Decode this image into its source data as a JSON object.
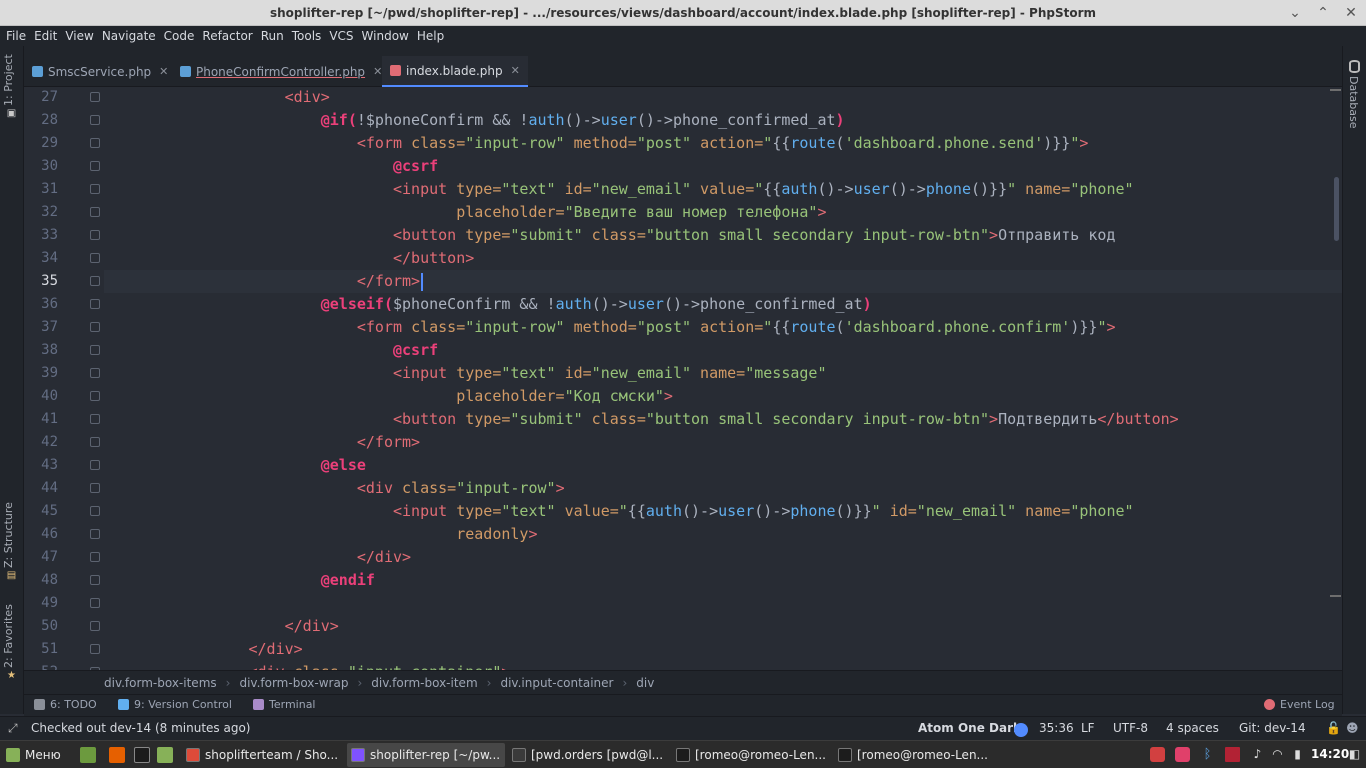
{
  "window": {
    "title": "shoplifter-rep [~/pwd/shoplifter-rep] - .../resources/views/dashboard/account/index.blade.php [shoplifter-rep] - PhpStorm"
  },
  "menu": [
    "File",
    "Edit",
    "View",
    "Navigate",
    "Code",
    "Refactor",
    "Run",
    "Tools",
    "VCS",
    "Window",
    "Help"
  ],
  "tabs": [
    {
      "label": "SmscService.php",
      "color": "#5c9fd6"
    },
    {
      "label": "PhoneConfirmController.php",
      "color": "#5c9fd6"
    },
    {
      "label": "index.blade.php",
      "color": "#e06c75",
      "active": true
    }
  ],
  "left_tools": {
    "project": "1: Project",
    "structure": "Z: Structure",
    "favorites": "2: Favorites"
  },
  "right_tools": {
    "database": "Database"
  },
  "editor": {
    "current_line": 35,
    "lines": [
      {
        "n": 27,
        "t": [
          [
            "",
            "                    "
          ],
          [
            "tg",
            "<div>"
          ]
        ]
      },
      {
        "n": 28,
        "t": [
          [
            "",
            "                        "
          ],
          [
            "bl",
            "@if("
          ],
          [
            "tx",
            "!$phoneConfirm && !"
          ],
          [
            "fn",
            "auth"
          ],
          [
            "tx",
            "()->"
          ],
          [
            "fn",
            "user"
          ],
          [
            "tx",
            "()->phone_confirmed_at"
          ],
          [
            "bl",
            ")"
          ]
        ]
      },
      {
        "n": 29,
        "t": [
          [
            "",
            "                            "
          ],
          [
            "tg",
            "<form "
          ],
          [
            "at",
            "class="
          ],
          [
            "st",
            "\"input-row\" "
          ],
          [
            "at",
            "method="
          ],
          [
            "st",
            "\"post\" "
          ],
          [
            "at",
            "action="
          ],
          [
            "st",
            "\""
          ],
          [
            "tx",
            "{{"
          ],
          [
            "fn",
            "route"
          ],
          [
            "tx",
            "("
          ],
          [
            "st",
            "'dashboard.phone.send'"
          ],
          [
            "tx",
            ")}}"
          ],
          [
            "st",
            "\""
          ],
          [
            "tg",
            ">"
          ]
        ]
      },
      {
        "n": 30,
        "t": [
          [
            "",
            "                                "
          ],
          [
            "bl",
            "@csrf"
          ]
        ]
      },
      {
        "n": 31,
        "t": [
          [
            "",
            "                                "
          ],
          [
            "tg",
            "<input "
          ],
          [
            "at",
            "type="
          ],
          [
            "st",
            "\"text\" "
          ],
          [
            "at",
            "id="
          ],
          [
            "st",
            "\"new_email\" "
          ],
          [
            "at",
            "value="
          ],
          [
            "st",
            "\""
          ],
          [
            "tx",
            "{{"
          ],
          [
            "fn",
            "auth"
          ],
          [
            "tx",
            "()->"
          ],
          [
            "fn",
            "user"
          ],
          [
            "tx",
            "()->"
          ],
          [
            "fn",
            "phone"
          ],
          [
            "tx",
            "()}}"
          ],
          [
            "st",
            "\" "
          ],
          [
            "at",
            "name="
          ],
          [
            "st",
            "\"phone\""
          ]
        ]
      },
      {
        "n": 32,
        "t": [
          [
            "",
            "                                       "
          ],
          [
            "at",
            "placeholder="
          ],
          [
            "st",
            "\"Введите ваш номер телефона\""
          ],
          [
            "tg",
            ">"
          ]
        ]
      },
      {
        "n": 33,
        "t": [
          [
            "",
            "                                "
          ],
          [
            "tg",
            "<button "
          ],
          [
            "at",
            "type="
          ],
          [
            "st",
            "\"submit\" "
          ],
          [
            "at",
            "class="
          ],
          [
            "st",
            "\"button small secondary input-row-btn\""
          ],
          [
            "tg",
            ">"
          ],
          [
            "tx",
            "Отправить код"
          ]
        ]
      },
      {
        "n": 34,
        "t": [
          [
            "",
            "                                "
          ],
          [
            "tg",
            "</button>"
          ]
        ]
      },
      {
        "n": 35,
        "t": [
          [
            "",
            "                            "
          ],
          [
            "tg",
            "</form>"
          ]
        ]
      },
      {
        "n": 36,
        "t": [
          [
            "",
            "                        "
          ],
          [
            "bl",
            "@elseif("
          ],
          [
            "tx",
            "$phoneConfirm && !"
          ],
          [
            "fn",
            "auth"
          ],
          [
            "tx",
            "()->"
          ],
          [
            "fn",
            "user"
          ],
          [
            "tx",
            "()->phone_confirmed_at"
          ],
          [
            "bl",
            ")"
          ]
        ]
      },
      {
        "n": 37,
        "t": [
          [
            "",
            "                            "
          ],
          [
            "tg",
            "<form "
          ],
          [
            "at",
            "class="
          ],
          [
            "st",
            "\"input-row\" "
          ],
          [
            "at",
            "method="
          ],
          [
            "st",
            "\"post\" "
          ],
          [
            "at",
            "action="
          ],
          [
            "st",
            "\""
          ],
          [
            "tx",
            "{{"
          ],
          [
            "fn",
            "route"
          ],
          [
            "tx",
            "("
          ],
          [
            "st",
            "'dashboard.phone.confirm'"
          ],
          [
            "tx",
            ")}}"
          ],
          [
            "st",
            "\""
          ],
          [
            "tg",
            ">"
          ]
        ]
      },
      {
        "n": 38,
        "t": [
          [
            "",
            "                                "
          ],
          [
            "bl",
            "@csrf"
          ]
        ]
      },
      {
        "n": 39,
        "t": [
          [
            "",
            "                                "
          ],
          [
            "tg",
            "<input "
          ],
          [
            "at",
            "type="
          ],
          [
            "st",
            "\"text\" "
          ],
          [
            "at",
            "id="
          ],
          [
            "st",
            "\"new_email\" "
          ],
          [
            "at",
            "name="
          ],
          [
            "st",
            "\"message\""
          ]
        ]
      },
      {
        "n": 40,
        "t": [
          [
            "",
            "                                       "
          ],
          [
            "at",
            "placeholder="
          ],
          [
            "st",
            "\"Код смски\""
          ],
          [
            "tg",
            ">"
          ]
        ]
      },
      {
        "n": 41,
        "t": [
          [
            "",
            "                                "
          ],
          [
            "tg",
            "<button "
          ],
          [
            "at",
            "type="
          ],
          [
            "st",
            "\"submit\" "
          ],
          [
            "at",
            "class="
          ],
          [
            "st",
            "\"button small secondary input-row-btn\""
          ],
          [
            "tg",
            ">"
          ],
          [
            "tx",
            "Подтвердить"
          ],
          [
            "tg",
            "</button>"
          ]
        ]
      },
      {
        "n": 42,
        "t": [
          [
            "",
            "                            "
          ],
          [
            "tg",
            "</form>"
          ]
        ]
      },
      {
        "n": 43,
        "t": [
          [
            "",
            "                        "
          ],
          [
            "bl",
            "@else"
          ]
        ]
      },
      {
        "n": 44,
        "t": [
          [
            "",
            "                            "
          ],
          [
            "tg",
            "<div "
          ],
          [
            "at",
            "class="
          ],
          [
            "st",
            "\"input-row\""
          ],
          [
            "tg",
            ">"
          ]
        ]
      },
      {
        "n": 45,
        "t": [
          [
            "",
            "                                "
          ],
          [
            "tg",
            "<input "
          ],
          [
            "at",
            "type="
          ],
          [
            "st",
            "\"text\" "
          ],
          [
            "at",
            "value="
          ],
          [
            "st",
            "\""
          ],
          [
            "tx",
            "{{"
          ],
          [
            "fn",
            "auth"
          ],
          [
            "tx",
            "()->"
          ],
          [
            "fn",
            "user"
          ],
          [
            "tx",
            "()->"
          ],
          [
            "fn",
            "phone"
          ],
          [
            "tx",
            "()}}"
          ],
          [
            "st",
            "\" "
          ],
          [
            "at",
            "id="
          ],
          [
            "st",
            "\"new_email\" "
          ],
          [
            "at",
            "name="
          ],
          [
            "st",
            "\"phone\""
          ]
        ]
      },
      {
        "n": 46,
        "t": [
          [
            "",
            "                                       "
          ],
          [
            "at",
            "readonly"
          ],
          [
            "tg",
            ">"
          ]
        ]
      },
      {
        "n": 47,
        "t": [
          [
            "",
            "                            "
          ],
          [
            "tg",
            "</div>"
          ]
        ]
      },
      {
        "n": 48,
        "t": [
          [
            "",
            "                        "
          ],
          [
            "bl",
            "@endif"
          ]
        ]
      },
      {
        "n": 49,
        "t": [
          [
            "",
            ""
          ]
        ]
      },
      {
        "n": 50,
        "t": [
          [
            "",
            "                    "
          ],
          [
            "tg",
            "</div>"
          ]
        ]
      },
      {
        "n": 51,
        "t": [
          [
            "",
            "                "
          ],
          [
            "tg",
            "</div>"
          ]
        ]
      },
      {
        "n": 52,
        "t": [
          [
            "",
            "                "
          ],
          [
            "tg",
            "<div "
          ],
          [
            "at",
            "class="
          ],
          [
            "st",
            "\"input-container\""
          ],
          [
            "tg",
            ">"
          ]
        ]
      }
    ]
  },
  "breadcrumbs": [
    "div.form-box-items",
    "div.form-box-wrap",
    "div.form-box-item",
    "div.input-container",
    "div"
  ],
  "tool_windows": {
    "todo": "6: TODO",
    "vcs": "9: Version Control",
    "terminal": "Terminal",
    "event_log": "Event Log"
  },
  "status": {
    "message": "Checked out dev-14 (8 minutes ago)",
    "theme": "Atom One Dark",
    "position": "35:36",
    "line_sep": "LF",
    "encoding": "UTF-8",
    "indent": "4 spaces",
    "branch": "Git: dev-14"
  },
  "taskbar": {
    "menu": "Меню",
    "apps": [
      {
        "label": "shoplifterteam / Sho...",
        "color": "#dd4b39"
      },
      {
        "label": "shoplifter-rep [~/pw...",
        "color": "#7f52ff",
        "active": true
      },
      {
        "label": "[pwd.orders [pwd@l...",
        "color": "#3a3a3a"
      },
      {
        "label": "[romeo@romeo-Len...",
        "color": "#1c1c1c"
      },
      {
        "label": "[romeo@romeo-Len...",
        "color": "#1c1c1c"
      }
    ],
    "clock": "14:20"
  },
  "colors": {
    "accent": "#528bff",
    "background": "#282c34",
    "panel": "#21252b"
  }
}
